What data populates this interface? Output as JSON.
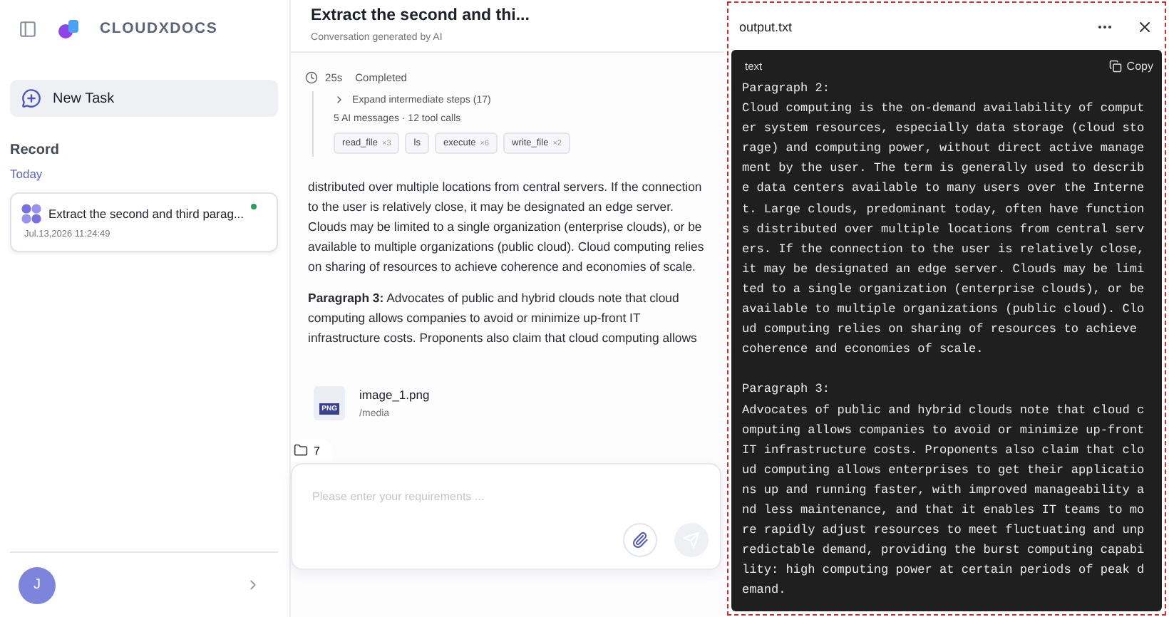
{
  "sidebar": {
    "brand": "CLOUDXDOCS",
    "new_task": "New Task",
    "section": "Record",
    "group": "Today",
    "records": [
      {
        "title": "Extract the second and third parag...",
        "time": "Jul.13,2026 11:24:49",
        "selected": true,
        "color": "#2e9e5b"
      }
    ],
    "user": {
      "initial": "J"
    }
  },
  "conversation": {
    "title": "Extract the second and thi...",
    "subtitle": "Conversation generated by AI",
    "status": {
      "duration": "25s",
      "label": "Completed"
    },
    "steps": {
      "expand": "Expand intermediate steps (17)",
      "summary": "5 AI messages · 12 tool calls",
      "expanded": false
    },
    "tools": [
      {
        "name": "read_file",
        "count": "×3"
      },
      {
        "name": "ls"
      },
      {
        "name": "execute",
        "count": "×6"
      },
      {
        "name": "write_file",
        "count": "×2"
      }
    ],
    "paragraphs": [
      "distributed over multiple locations from central servers. If the connection to the user is relatively close, it may be designated an edge server. Clouds may be limited to a single organization (enterprise clouds), or be available to multiple organizations (public cloud). Cloud computing relies on sharing of resources to achieve coherence and economies of scale.",
      "**Paragraph 3:** Advocates of public and hybrid clouds note that cloud computing allows companies to avoid or minimize up-front IT infrastructure costs. Proponents also claim that cloud computing allows"
    ],
    "attachment": {
      "name": "image_1.png",
      "path": "/media",
      "type": "PNG"
    },
    "files_count": "7",
    "input": {
      "placeholder": "Please enter your requirements ..."
    }
  },
  "file_panel": {
    "title": "output.txt",
    "language": "text",
    "copy": "Copy",
    "content": "Paragraph 2:\nCloud computing is the on-demand availability of comput\ner system resources, especially data storage (cloud sto\nrage) and computing power, without direct active manage\nment by the user. The term is generally used to describ\ne data centers available to many users over the Interne\nt. Large clouds, predominant today, often have function\ns distributed over multiple locations from central serv\ners. If the connection to the user is relatively close,\nit may be designated an edge server. Clouds may be limi\nted to a single organization (enterprise clouds), or be\navailable to multiple organizations (public cloud). Clo\nud computing relies on sharing of resources to achieve\ncoherence and economies of scale.\n\nParagraph 3:\nAdvocates of public and hybrid clouds note that cloud c\nomputing allows companies to avoid or minimize up-front\nIT infrastructure costs. Proponents also claim that clo\nud computing allows enterprises to get their applicatio\nns up and running faster, with improved manageability a\nnd less maintenance, and that it enables IT teams to mo\nre rapidly adjust resources to meet fluctuating and unp\nredictable demand, providing the burst computing capabi\nlity: high computing power at certain periods of peak d\nemand."
  }
}
